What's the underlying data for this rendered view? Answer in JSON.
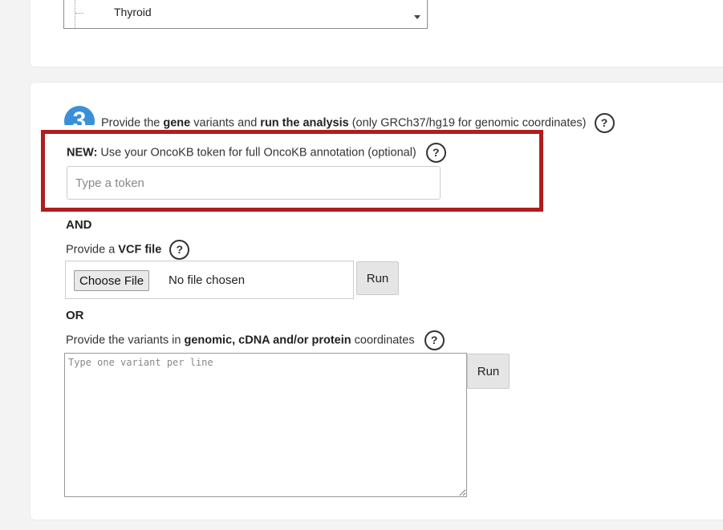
{
  "tissue_list": {
    "visible_item": "Thyroid"
  },
  "step3": {
    "number": "3",
    "intro_1": "Provide the ",
    "intro_gene": "gene",
    "intro_2": " variants and ",
    "intro_run": "run the analysis",
    "intro_3": " (only GRCh37/hg19 for genomic coordinates)",
    "help": "?"
  },
  "oncokb": {
    "new_label": "NEW:",
    "text": " Use your OncoKB token for full OncoKB annotation (optional)",
    "placeholder": "Type a token",
    "help": "?"
  },
  "and_label": "AND",
  "vcf": {
    "prefix": "Provide a ",
    "bold": "VCF file",
    "help": "?",
    "choose_button": "Choose File",
    "status": "No file chosen",
    "run": "Run"
  },
  "or_label": "OR",
  "variants": {
    "prefix": "Provide the variants in ",
    "bold": "genomic, cDNA and/or protein",
    "suffix": " coordinates",
    "help": "?",
    "placeholder": "Type one variant per line",
    "run": "Run"
  }
}
